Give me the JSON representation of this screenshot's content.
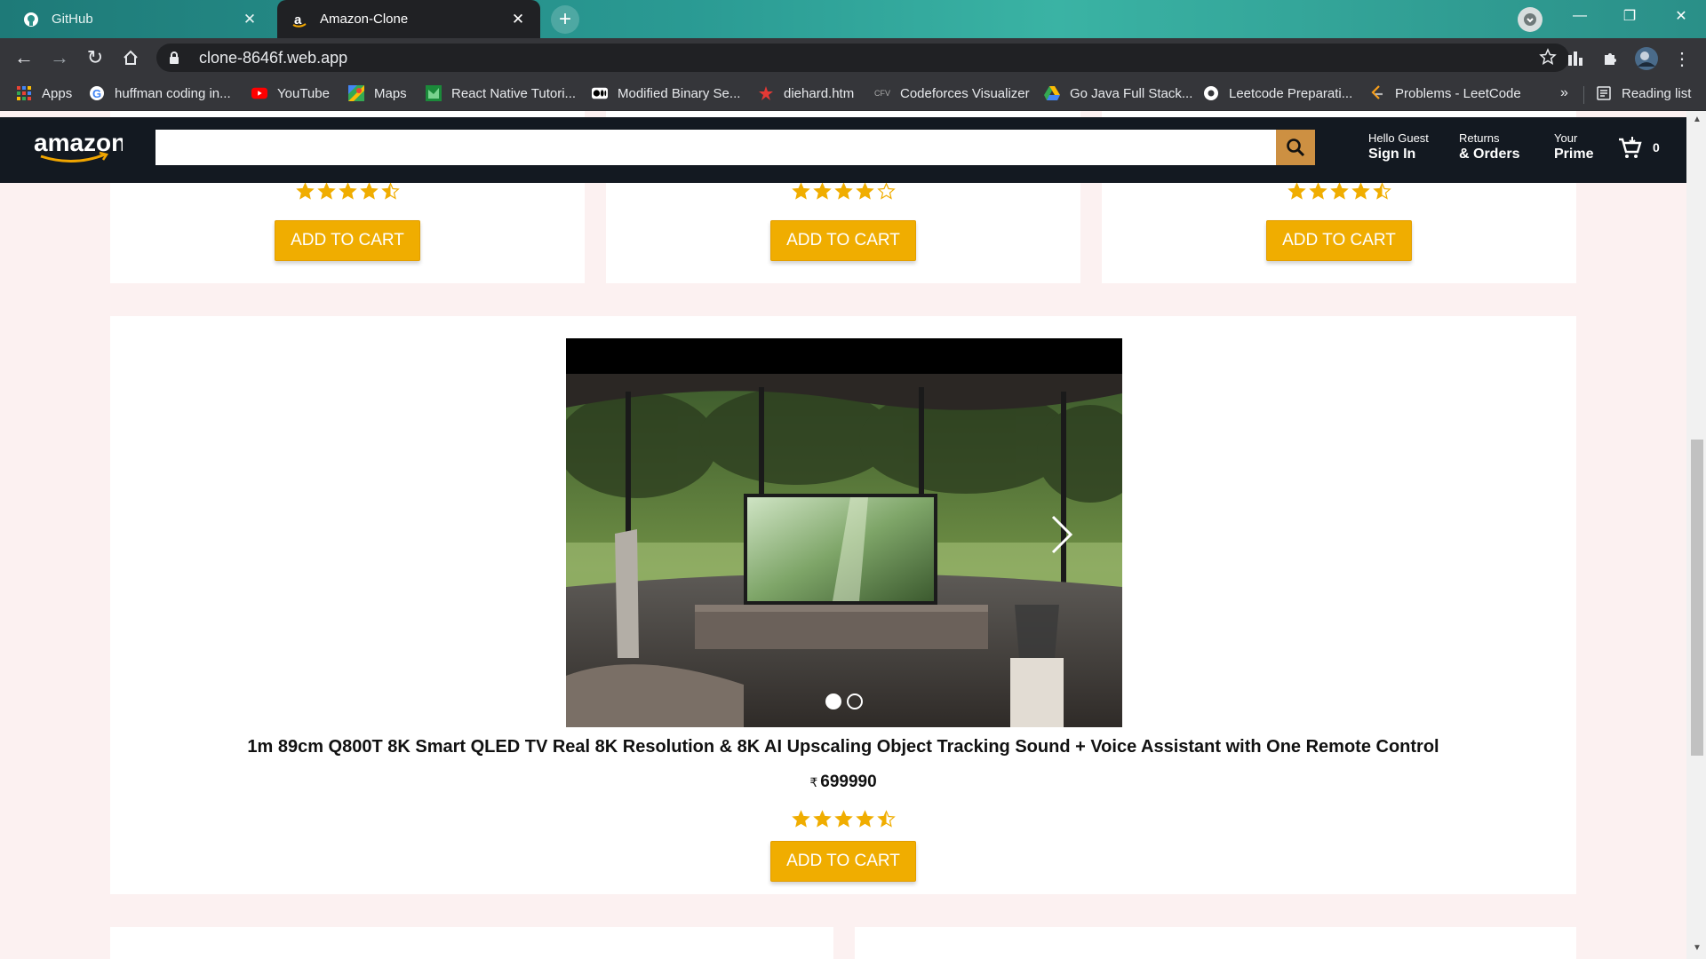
{
  "browser": {
    "tabs": [
      {
        "title": "GitHub",
        "active": false
      },
      {
        "title": "Amazon-Clone",
        "active": true
      }
    ],
    "url": "clone-8646f.web.app",
    "bookmarks": [
      {
        "label": "Apps",
        "icon": "apps-grid-icon"
      },
      {
        "label": "huffman coding in...",
        "icon": "google-icon"
      },
      {
        "label": "YouTube",
        "icon": "youtube-icon"
      },
      {
        "label": "Maps",
        "icon": "maps-icon"
      },
      {
        "label": "React Native Tutori...",
        "icon": "react-native-icon"
      },
      {
        "label": "Modified Binary Se...",
        "icon": "medium-icon"
      },
      {
        "label": "diehard.htm",
        "icon": "star-bookmark-icon"
      },
      {
        "label": "Codeforces Visualizer",
        "icon": "cfv-icon"
      },
      {
        "label": "Go Java Full Stack...",
        "icon": "drive-icon"
      },
      {
        "label": "Leetcode Preparati...",
        "icon": "chrome-icon"
      },
      {
        "label": "Problems - LeetCode",
        "icon": "leetcode-icon"
      }
    ],
    "overflow": "»",
    "reading_list": "Reading list"
  },
  "header": {
    "logo": "amazon",
    "search_placeholder": "",
    "options": [
      {
        "line1": "Hello Guest",
        "line2": "Sign In"
      },
      {
        "line1": "Returns",
        "line2": "& Orders"
      },
      {
        "line1": "Your",
        "line2": "Prime"
      }
    ],
    "basket_count": "0"
  },
  "colors": {
    "header_bg": "#131921",
    "search_button": "#cd9042",
    "cart_button": "#f0ad00",
    "star": "#f0ad00",
    "page_bg": "#fcf1f1"
  },
  "top_row_products": [
    {
      "rating": 4.5,
      "button_label": "ADD TO CART"
    },
    {
      "rating": 4,
      "button_label": "ADD TO CART"
    },
    {
      "rating": 4.5,
      "button_label": "ADD TO CART"
    }
  ],
  "featured_product": {
    "title": "1m 89cm Q800T 8K Smart QLED TV Real 8K Resolution & 8K AI Upscaling Object Tracking Sound + Voice Assistant with One Remote Control",
    "currency": "₹",
    "price": "699990",
    "rating": 4.5,
    "button_label": "ADD TO CART",
    "carousel_slides": 2,
    "carousel_active_slide": 1
  }
}
